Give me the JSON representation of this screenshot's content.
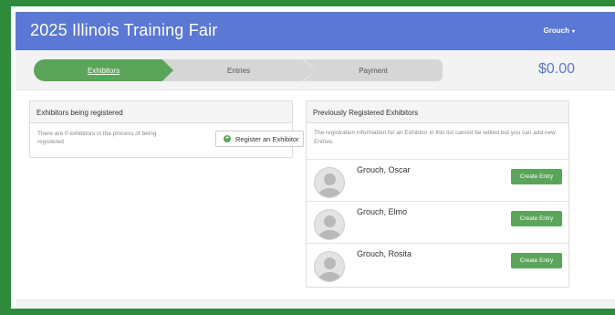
{
  "navbar": {
    "title": "2025 Illinois Training Fair",
    "user": "Grouch",
    "user_caret": "▾"
  },
  "wizard": {
    "steps": [
      {
        "label": "Exhibitors",
        "active": true
      },
      {
        "label": "Entries",
        "active": false
      },
      {
        "label": "Payment",
        "active": false
      }
    ],
    "total": "$0.00"
  },
  "exhibitors_registering": {
    "heading": "Exhibitors being registered",
    "description": "There are 0 exhibitors in the process of being registered",
    "register_button": "Register an Exhibitor",
    "register_icon": "plus-circle-icon"
  },
  "previously_registered": {
    "heading": "Previously Registered Exhibitors",
    "description": "The registration information for an Exhibitor in this list cannot be edited but you can add new Entries.",
    "exhibitors": [
      {
        "name": "Grouch, Oscar",
        "button": "Create Entry"
      },
      {
        "name": "Grouch, Elmo",
        "button": "Create Entry"
      },
      {
        "name": "Grouch, Rosita",
        "button": "Create Entry"
      }
    ]
  },
  "colors": {
    "navbar": "#5b78d4",
    "accent_green": "#5aa55a",
    "frame_border": "#2e8b3e"
  }
}
